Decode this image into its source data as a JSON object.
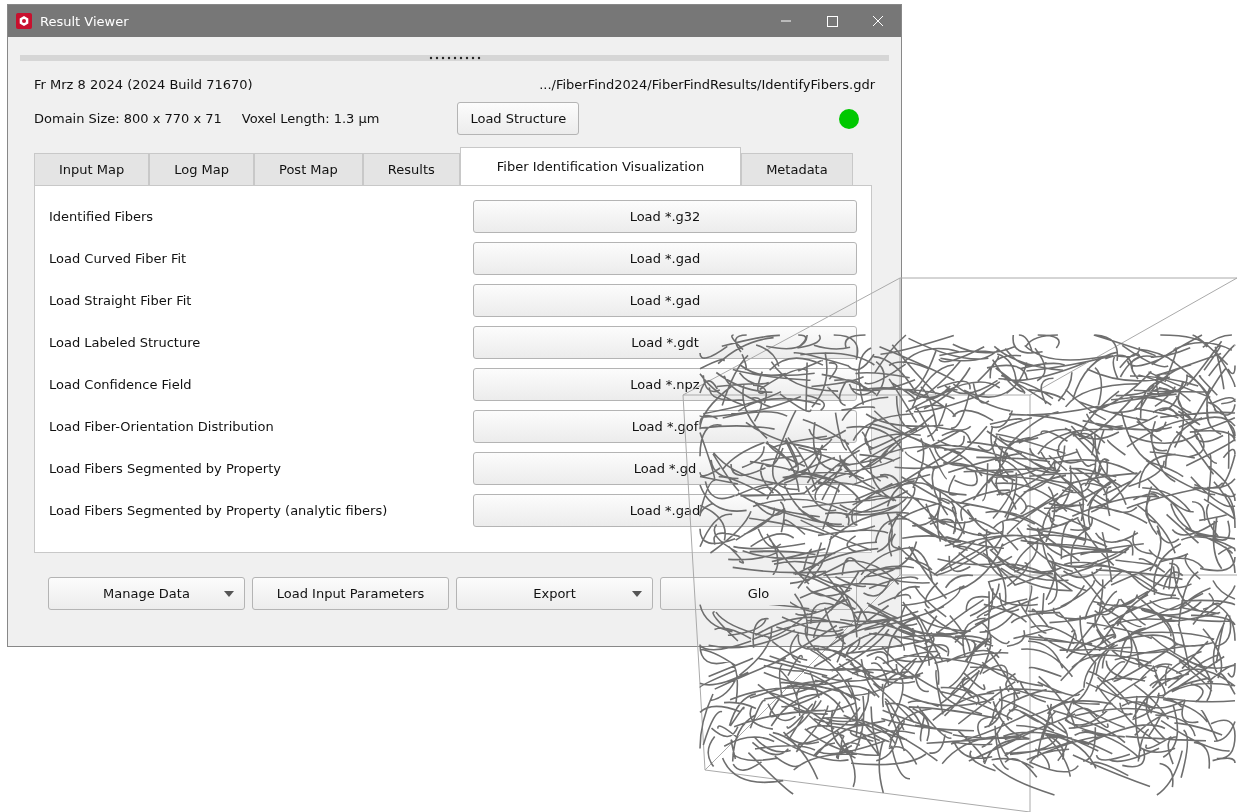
{
  "window": {
    "title": "Result Viewer"
  },
  "info": {
    "version": "Fr Mrz 8 2024 (2024 Build 71670)",
    "path": ".../FiberFind2024/FiberFindResults/IdentifyFibers.gdr",
    "domain_size": "Domain Size: 800 x 770 x 71",
    "voxel_length": "Voxel Length: 1.3 µm",
    "load_button": "Load Structure",
    "status_ok": true
  },
  "tabs": [
    {
      "label": "Input Map",
      "selected": false
    },
    {
      "label": "Log Map",
      "selected": false
    },
    {
      "label": "Post Map",
      "selected": false
    },
    {
      "label": "Results",
      "selected": false
    },
    {
      "label": "Fiber Identification Visualization",
      "selected": true
    },
    {
      "label": "Metadata",
      "selected": false
    }
  ],
  "rows": [
    {
      "label": "Identified Fibers",
      "button": "Load *.g32"
    },
    {
      "label": "Load Curved Fiber Fit",
      "button": "Load *.gad"
    },
    {
      "label": "Load Straight Fiber Fit",
      "button": "Load *.gad"
    },
    {
      "label": "Load Labeled Structure",
      "button": "Load *.gdt"
    },
    {
      "label": "Load Confidence Field",
      "button": "Load *.npz"
    },
    {
      "label": "Load Fiber-Orientation Distribution",
      "button": "Load *.gof"
    },
    {
      "label": "Load Fibers Segmented by Property",
      "button": "Load *.gd"
    },
    {
      "label": "Load Fibers Segmented by Property (analytic fibers)",
      "button": "Load *.gad"
    }
  ],
  "bottom_buttons": [
    {
      "label": "Manage Data",
      "dropdown": true
    },
    {
      "label": "Load Input Parameters",
      "dropdown": false
    },
    {
      "label": "Export",
      "dropdown": true
    },
    {
      "label": "Glo",
      "dropdown": false
    }
  ]
}
